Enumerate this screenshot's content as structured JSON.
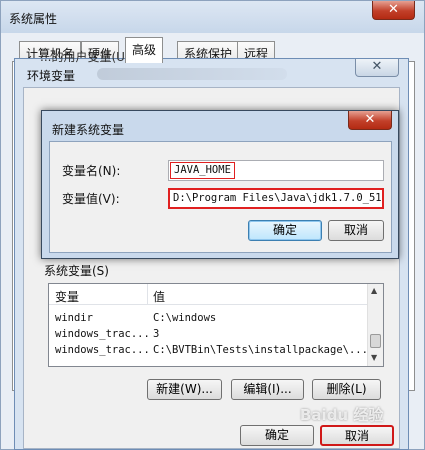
{
  "system_properties": {
    "title": "系统属性",
    "close_glyph": "✕",
    "tabs": [
      {
        "label": "计算机名"
      },
      {
        "label": "硬件"
      },
      {
        "label": "高级"
      },
      {
        "label": "系统保护"
      },
      {
        "label": "远程"
      }
    ],
    "active_tab": "高级"
  },
  "environment_variables": {
    "title": "环境变量",
    "close_glyph": "✕",
    "user_vars_label": "...的用户变量(U)",
    "system_vars_label": "系统变量(S)",
    "system_table": {
      "headers": [
        "变量",
        "值"
      ],
      "rows": [
        {
          "var": "windir",
          "value": "C:\\windows"
        },
        {
          "var": "windows_trac...",
          "value": "3"
        },
        {
          "var": "windows_trac...",
          "value": "C:\\BVTBin\\Tests\\installpackage\\..."
        }
      ]
    },
    "buttons": {
      "new": "新建(W)...",
      "edit": "编辑(I)...",
      "delete": "删除(L)",
      "ok": "确定",
      "cancel": "取消"
    }
  },
  "new_system_variable": {
    "title": "新建系统变量",
    "close_glyph": "✕",
    "name_label": "变量名(N):",
    "value_label": "变量值(V):",
    "name_value": "JAVA_HOME",
    "value_value": "D:\\Program Files\\Java\\jdk1.7.0_51",
    "ok": "确定",
    "cancel": "取消"
  },
  "watermark": "Baidu 经验"
}
